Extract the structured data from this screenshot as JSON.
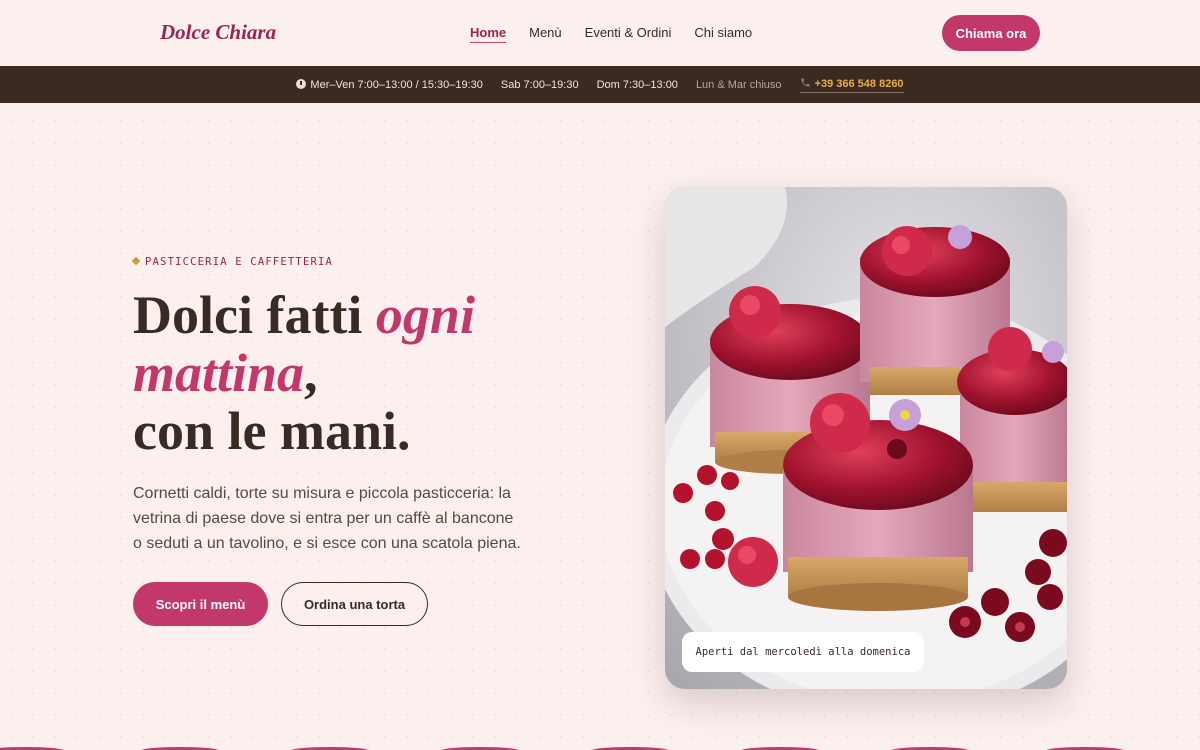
{
  "brand": {
    "name": "Dolce Chiara"
  },
  "nav": {
    "items": [
      {
        "label": "Home",
        "active": true
      },
      {
        "label": "Menù"
      },
      {
        "label": "Eventi & Ordini"
      },
      {
        "label": "Chi siamo"
      }
    ],
    "cta": "Chiama ora"
  },
  "hours": {
    "weekdays": "Mer–Ven 7:00–13:00 / 15:30–19:30",
    "saturday": "Sab 7:00–19:30",
    "sunday": "Dom 7:30–13:00",
    "closed": "Lun & Mar chiuso",
    "phone": "+39 366 548 8260",
    "clock_icon": "clock-icon",
    "phone_icon": "phone-icon"
  },
  "hero": {
    "eyebrow": "PASTICCERIA E CAFFETTERIA",
    "title_part1": "Dolci fatti ",
    "title_emphasis": "ogni mattina",
    "title_part2": ",",
    "title_line3": "con le mani.",
    "lead": "Cornetti caldi, torte su misura e piccola pasticceria: la vetrina di paese dove si entra per un caffè al bancone o seduti a un tavolino, e si esce con una scatola piena.",
    "primary_button": "Scopri il menù",
    "secondary_button": "Ordina una torta",
    "image_caption": "Aperti dal mercoledì alla domenica"
  },
  "colors": {
    "accent": "#c2386a",
    "brand": "#9b2452",
    "dark": "#3b2a21",
    "background": "#fbf0ee",
    "gold": "#e7b04a"
  }
}
